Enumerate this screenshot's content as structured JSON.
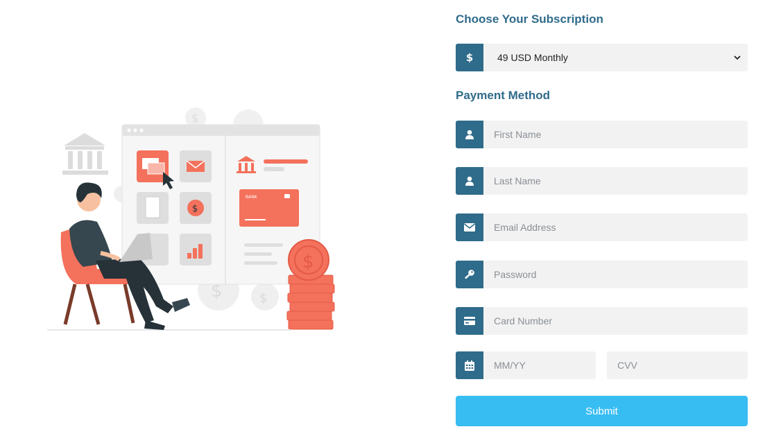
{
  "subscription": {
    "heading": "Choose Your Subscription",
    "selected": "49 USD Monthly"
  },
  "payment": {
    "heading": "Payment Method",
    "first_name_placeholder": "First Name",
    "last_name_placeholder": "Last Name",
    "email_placeholder": "Email Address",
    "password_placeholder": "Password",
    "card_number_placeholder": "Card Number",
    "expiry_placeholder": "MM/YY",
    "cvv_placeholder": "CVV",
    "submit_label": "Submit"
  },
  "illustration": {
    "card_label": "BANK"
  },
  "colors": {
    "accent": "#2f6b8a",
    "button": "#38bdf3",
    "field_bg": "#f2f2f2",
    "illustration_coral": "#f4715c"
  }
}
